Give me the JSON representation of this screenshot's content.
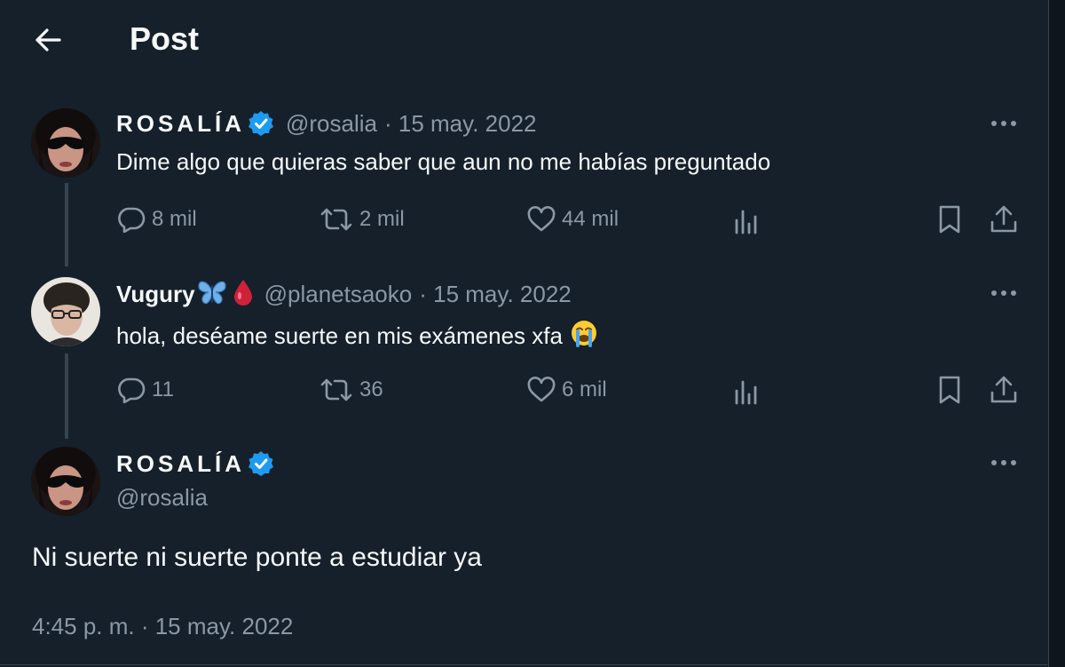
{
  "header": {
    "title": "Post",
    "back_icon": "arrow-left-icon"
  },
  "colors": {
    "background": "#15202b",
    "text_primary": "#f7f9f9",
    "text_secondary": "#8b98a5",
    "verified_badge": "#1d9bf0",
    "border": "#38444d"
  },
  "tweets": [
    {
      "display_name": "ROSALÍA",
      "verified": true,
      "handle": "@rosalia",
      "date": "· 15 may. 2022",
      "text": "Dime algo que quieras saber que aun no me habías preguntado",
      "actions": {
        "replies": "8 mil",
        "reposts": "2 mil",
        "likes": "44 mil"
      }
    },
    {
      "display_name": "Vugury",
      "name_emojis": [
        "butterfly-emoji",
        "drop-of-blood-emoji"
      ],
      "verified": false,
      "handle": "@planetsaoko",
      "date": "· 15 may. 2022",
      "text": "hola, deséame suerte en mis exámenes xfa",
      "text_emoji": "loudly-crying-face-emoji",
      "actions": {
        "replies": "11",
        "reposts": "36",
        "likes": "6 mil"
      }
    }
  ],
  "main_tweet": {
    "display_name": "ROSALÍA",
    "verified": true,
    "handle": "@rosalia",
    "text": "Ni suerte ni suerte ponte a estudiar ya",
    "timestamp": "4:45 p. m. · 15 may. 2022"
  }
}
